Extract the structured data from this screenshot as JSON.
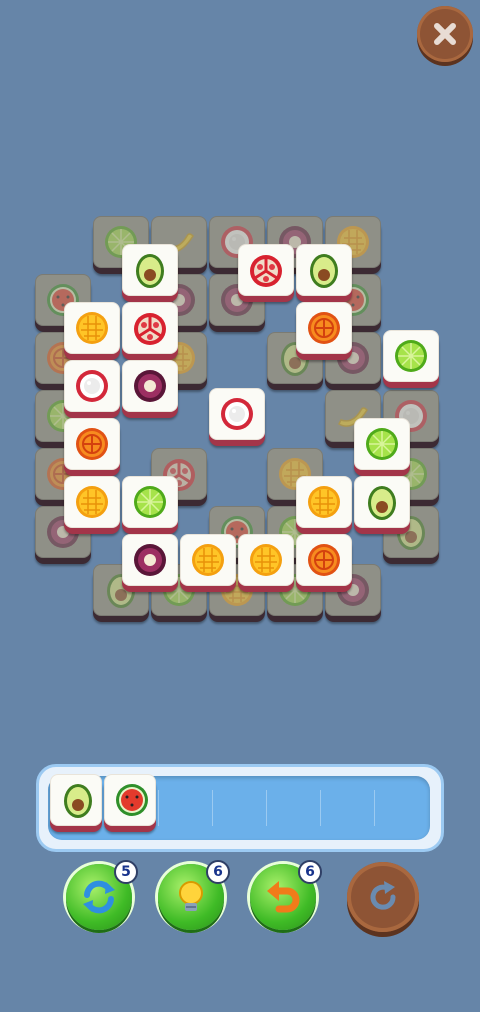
{
  "colors": {
    "background": "#6685a8",
    "tile_base_active": "#a33549",
    "tile_base_dim": "#3c2a33",
    "tray_fill": "#6bb0ea",
    "booster_green": "#3fbb26",
    "wood": "#8e5435"
  },
  "header": {
    "close_icon": "close-icon"
  },
  "tray": {
    "capacity": 7,
    "tiles": [
      {
        "fruit": "avocado"
      },
      {
        "fruit": "watermelon"
      }
    ]
  },
  "boosters": [
    {
      "name": "shuffle",
      "icon": "shuffle-icon",
      "count": "5"
    },
    {
      "name": "hint",
      "icon": "lightbulb-icon",
      "count": "6"
    },
    {
      "name": "undo",
      "icon": "undo-icon",
      "count": "6"
    }
  ],
  "restart": {
    "icon": "restart-icon"
  },
  "board": {
    "active_tiles": [
      {
        "fruit": "avocado"
      },
      {
        "fruit": "pomegranate"
      },
      {
        "fruit": "avocado"
      },
      {
        "fruit": "mango"
      },
      {
        "fruit": "pomegranate"
      },
      {
        "fruit": "orange"
      },
      {
        "fruit": "lime"
      },
      {
        "fruit": "lychee"
      },
      {
        "fruit": "mangosteen"
      },
      {
        "fruit": "lychee"
      },
      {
        "fruit": "orange"
      },
      {
        "fruit": "lime"
      },
      {
        "fruit": "mango"
      },
      {
        "fruit": "lime"
      },
      {
        "fruit": "mango"
      },
      {
        "fruit": "avocado"
      },
      {
        "fruit": "mangosteen"
      },
      {
        "fruit": "mango"
      },
      {
        "fruit": "mango"
      },
      {
        "fruit": "orange"
      }
    ],
    "covered_tiles": [
      {
        "fruit": "lime"
      },
      {
        "fruit": "banana"
      },
      {
        "fruit": "lychee"
      },
      {
        "fruit": "mangosteen"
      },
      {
        "fruit": "mango"
      },
      {
        "fruit": "watermelon"
      },
      {
        "fruit": "mangosteen"
      },
      {
        "fruit": "mangosteen"
      },
      {
        "fruit": "watermelon"
      },
      {
        "fruit": "orange"
      },
      {
        "fruit": "mango"
      },
      {
        "fruit": "avocado"
      },
      {
        "fruit": "mangosteen"
      },
      {
        "fruit": "lime"
      },
      {
        "fruit": "banana"
      },
      {
        "fruit": "lychee"
      },
      {
        "fruit": "orange"
      },
      {
        "fruit": "pomegranate"
      },
      {
        "fruit": "mango"
      },
      {
        "fruit": "lime"
      },
      {
        "fruit": "mangosteen"
      },
      {
        "fruit": "watermelon"
      },
      {
        "fruit": "lime"
      },
      {
        "fruit": "avocado"
      },
      {
        "fruit": "avocado"
      },
      {
        "fruit": "lime"
      },
      {
        "fruit": "mango"
      },
      {
        "fruit": "lime"
      },
      {
        "fruit": "mangosteen"
      }
    ]
  }
}
